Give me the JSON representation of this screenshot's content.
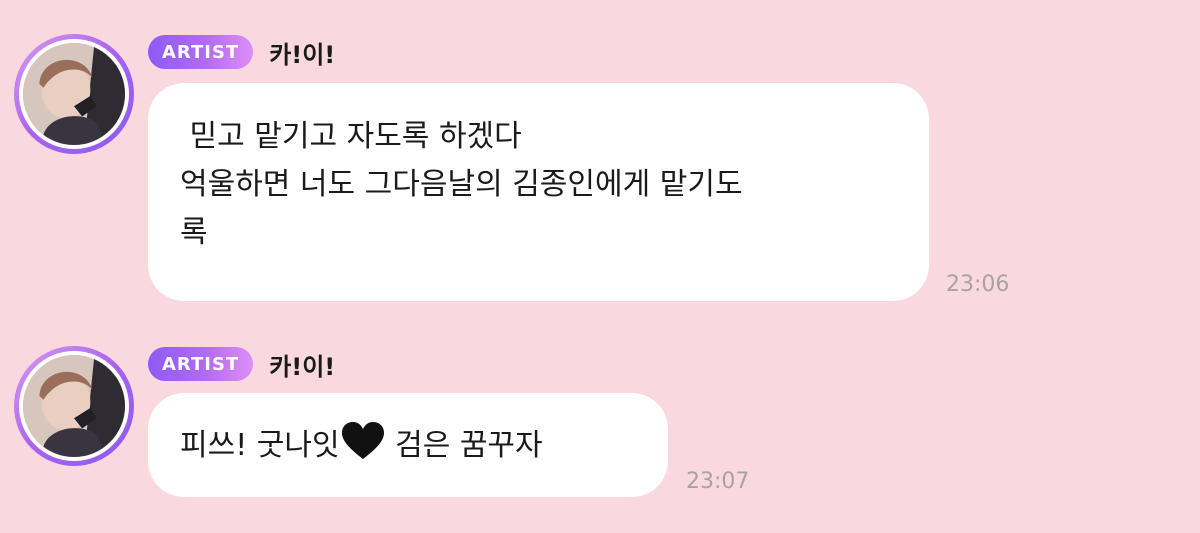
{
  "messages": [
    {
      "badge": "ARTIST",
      "sender": "카!이!",
      "lines": [
        " 믿고 맡기고 자도록 하겠다",
        "억울하면 너도 그다음날의 김종인에게 맡기도",
        "록"
      ],
      "time": "23:06"
    },
    {
      "badge": "ARTIST",
      "sender": "카!이!",
      "text_before_icon": "피쓰! 굿나잇",
      "icon": "black-heart-icon",
      "text_after_icon": " 검은 꿈꾸자",
      "time": "23:07"
    }
  ],
  "colors": {
    "background": "#f9d9df",
    "bubble": "#ffffff",
    "badge_gradient_start": "#8b5cf6",
    "badge_gradient_end": "#dd8ff5",
    "timestamp": "#a8a2a4"
  }
}
